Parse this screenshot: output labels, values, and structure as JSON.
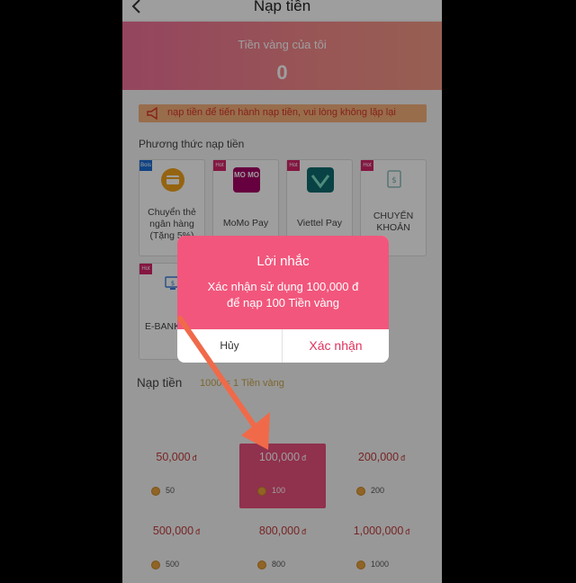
{
  "header": {
    "title": "Nạp tiền"
  },
  "balance": {
    "label": "Tiền vàng của tôi",
    "value": "0"
  },
  "notice": {
    "text": "nạp tiền để tiến hành nạp tiền, vui lòng không lặp lại"
  },
  "methods": {
    "title": "Phương thức nạp tiền",
    "items": [
      {
        "label": "Chuyển thẻ ngân hàng (Tặng 5%)",
        "badge": "Bois",
        "icon": "bank-card-icon"
      },
      {
        "label": "MoMo Pay",
        "badge": "Hot",
        "icon": "momo-logo",
        "logo_text": "MO MO"
      },
      {
        "label": "Viettel Pay",
        "badge": "Hot",
        "icon": "viettel-pay-logo"
      },
      {
        "label": "CHUYỂN KHOẢN",
        "badge": "Hot",
        "icon": "bank-transfer-icon"
      },
      {
        "label": "E-BANK",
        "badge": "Hot",
        "icon": "e-bank-icon"
      }
    ]
  },
  "topup": {
    "label": "Nạp tiền",
    "rate": "1000 = 1 Tiền vàng",
    "amounts": [
      {
        "value": "50,000",
        "currency": "đ",
        "coins": "50"
      },
      {
        "value": "100,000",
        "currency": "đ",
        "coins": "100",
        "selected": true
      },
      {
        "value": "200,000",
        "currency": "đ",
        "coins": "200"
      },
      {
        "value": "500,000",
        "currency": "đ",
        "coins": "500"
      },
      {
        "value": "800,000",
        "currency": "đ",
        "coins": "800"
      },
      {
        "value": "1,000,000",
        "currency": "đ",
        "coins": "1000"
      }
    ]
  },
  "modal": {
    "title": "Lời nhắc",
    "message_line1": "Xác nhận sử dụng 100,000 đ",
    "message_line2": "để nạp 100 Tiền vàng",
    "cancel_label": "Hủy",
    "confirm_label": "Xác nhận"
  },
  "colors": {
    "accent": "#f2567c",
    "arrow": "#f06a4a",
    "gold": "#c9a54c"
  }
}
